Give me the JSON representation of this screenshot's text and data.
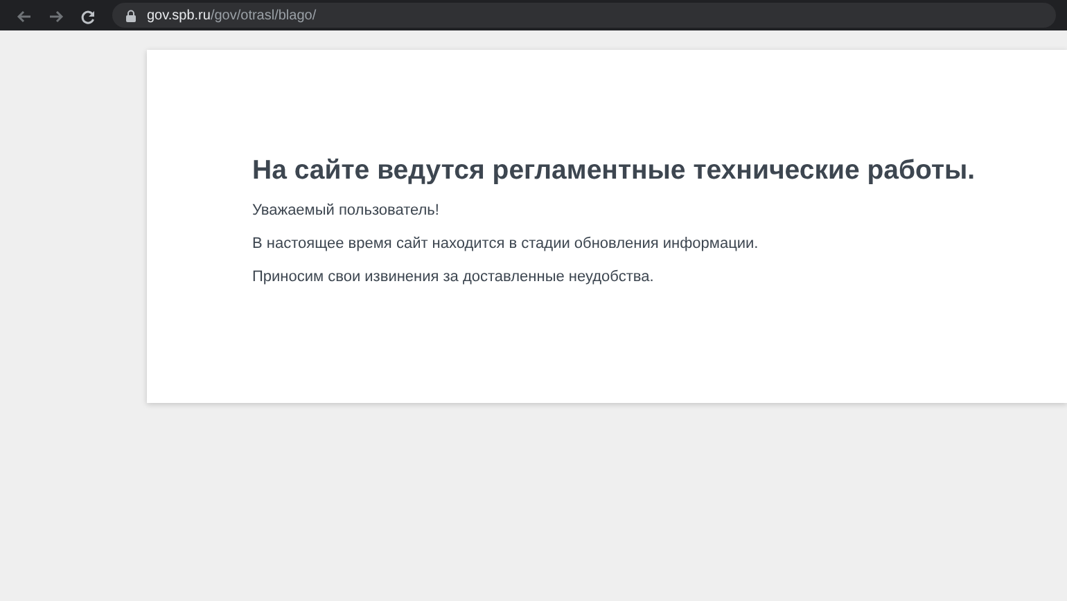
{
  "browser": {
    "url_host": "gov.spb.ru",
    "url_path": "/gov/otrasl/blago/"
  },
  "page": {
    "title": "На сайте ведутся регламентные технические работы.",
    "paragraphs": [
      "Уважаемый пользователь!",
      "В настоящее время сайт находится в стадии обновления информации.",
      "Приносим свои извинения за доставленные неудобства."
    ]
  }
}
